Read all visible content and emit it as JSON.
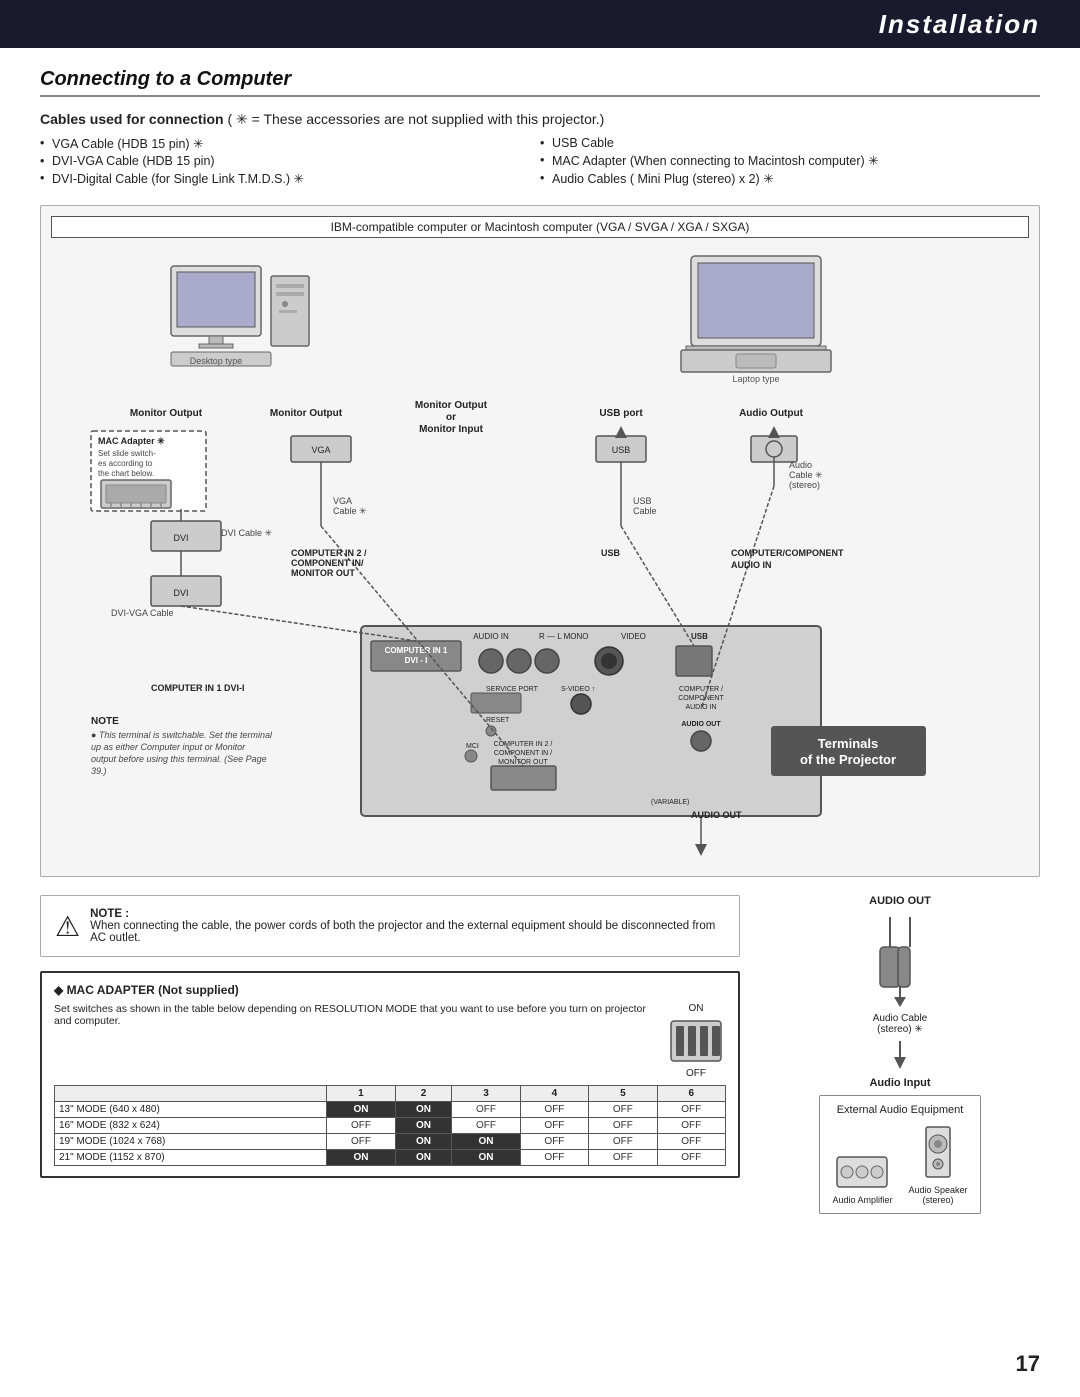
{
  "header": {
    "title": "Installation"
  },
  "page_number": "17",
  "section": {
    "title": "Connecting to a Computer"
  },
  "cables": {
    "heading": "Cables used for connection",
    "heading_note": "( ✳ = These accessories are not supplied with this projector.)",
    "left_list": [
      "VGA Cable (HDB 15 pin) ✳",
      "DVI-VGA Cable (HDB 15 pin)",
      "DVI-Digital Cable (for Single Link T.M.D.S.) ✳"
    ],
    "right_list": [
      "USB Cable",
      "MAC Adapter (When connecting to Macintosh computer) ✳",
      "Audio Cables ( Mini Plug (stereo) x 2) ✳"
    ]
  },
  "ibm_label": "IBM-compatible computer or Macintosh computer (VGA / SVGA / XGA / SXGA)",
  "computer_types": {
    "desktop": "Desktop type",
    "laptop": "Laptop type"
  },
  "connectors": {
    "monitor_output_1": "Monitor Output",
    "monitor_output_2": "Monitor Output",
    "monitor_output_3": "Monitor Output\nor\nMonitor Input",
    "usb_port": "USB port",
    "audio_output": "Audio Output"
  },
  "cable_labels": {
    "dvi_cable": "DVI Cable ✳",
    "dvi_vga": "DVI-VGA Cable",
    "vga_cable": "VGA\nCable ✳",
    "usb_cable": "USB\nCable",
    "audio_cable": "Audio\nCable ✳\n(stereo)"
  },
  "port_labels": {
    "comp_in1_dvi_i_top": "COMPUTER IN 1 DVI-I",
    "comp_in1_dvi_i_bottom": "COMPUTER IN 1 DVI-I",
    "comp_in2": "COMPUTER IN 2 /\nCOMPONENT IN/\nMONITOR OUT",
    "usb": "USB",
    "comp_component_audio": "COMPUTER/COMPONENT\nAUDIO IN"
  },
  "projector_back_labels": {
    "computer_in1_dvi": "COMPUTER IN 1\nDVI - I",
    "audio_in": "AUDIO IN",
    "r_l_mono": "R — L MONO",
    "video": "VIDEO",
    "usb": "USB",
    "service_port": "SERVICE PORT",
    "s_video": "S-VIDEO",
    "computer_component": "COMPUTER /\nCOMPONENT",
    "audio_in2": "AUDIO IN",
    "audio_out": "AUDIO OUT",
    "reset": "RESET",
    "mci": "MCI",
    "comp_in2_comp_in_monitor": "COMPUTER IN 2 /\nCOMPONENT IN /\nMONITOR OUT",
    "variable": "(VARIABLE)"
  },
  "terminals_box": {
    "line1": "Terminals",
    "line2": "of the Projector"
  },
  "note_left": {
    "title": "NOTE",
    "text": "This terminal is switchable. Set the terminal up as either Computer input or Monitor output before using this terminal. (See Page 39.)"
  },
  "note_warning": {
    "title": "NOTE :",
    "text": "When connecting the cable, the power cords of both the projector and the external equipment should be disconnected from AC outlet."
  },
  "mac_adapter": {
    "title": "◆ MAC ADAPTER (Not supplied)",
    "description": "Set switches as shown in the table below depending on RESOLUTION MODE that you want to use before you turn on projector and computer.",
    "on_label": "ON",
    "off_label": "OFF",
    "table_headers": [
      "",
      "1",
      "2",
      "3",
      "4",
      "5",
      "6"
    ],
    "rows": [
      {
        "mode": "13\" MODE (640 x 480)",
        "values": [
          "ON",
          "ON",
          "OFF",
          "OFF",
          "OFF",
          "OFF"
        ]
      },
      {
        "mode": "16\" MODE (832 x 624)",
        "values": [
          "OFF",
          "ON",
          "OFF",
          "OFF",
          "OFF",
          "OFF"
        ]
      },
      {
        "mode": "19\" MODE (1024 x 768)",
        "values": [
          "OFF",
          "ON",
          "ON",
          "OFF",
          "OFF",
          "OFF"
        ]
      },
      {
        "mode": "21\" MODE (1152 x 870)",
        "values": [
          "ON",
          "ON",
          "ON",
          "OFF",
          "OFF",
          "OFF"
        ]
      }
    ]
  },
  "audio_out_label": "AUDIO OUT",
  "audio_cable_stereo": "Audio Cable\n(stereo) ✳",
  "audio_input_label": "Audio Input",
  "ext_audio_label": "External Audio Equipment",
  "audio_amplifier": "Audio Amplifier",
  "audio_speaker": "Audio Speaker\n(stereo)"
}
